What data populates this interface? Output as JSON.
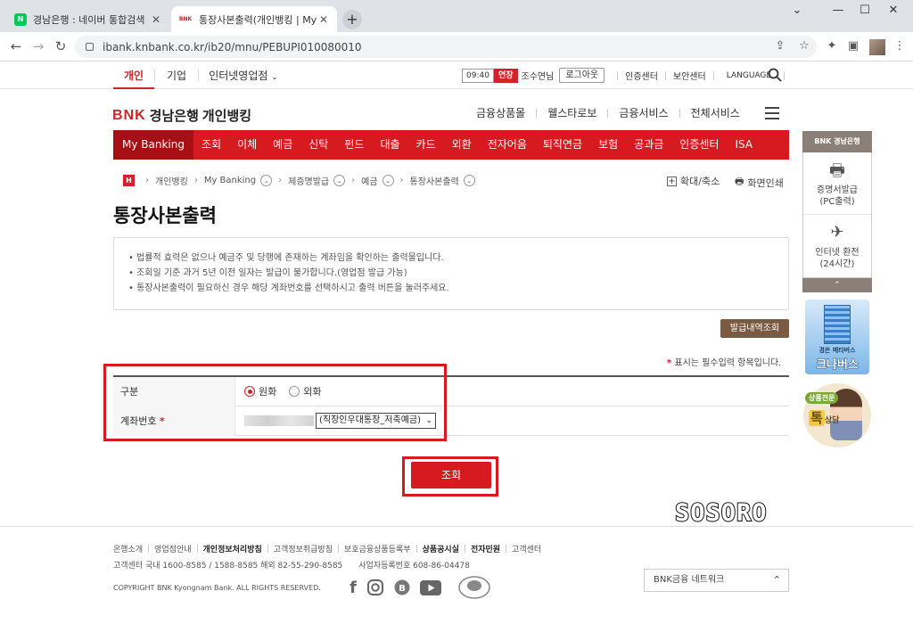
{
  "browser": {
    "tabs": [
      {
        "title": "경남은행 : 네이버 통합검색",
        "favicon": "N"
      },
      {
        "title": "통장사본출력(개인뱅킹 | My Ba",
        "favicon": "BNK"
      }
    ],
    "url": "ibank.knbank.co.kr/ib20/mnu/PEBUPI010080010"
  },
  "util": {
    "tabs": [
      "개인",
      "기업",
      "인터넷영업점"
    ],
    "timer": "09:40",
    "extend": "연장",
    "user": "조수연님",
    "logout": "로그아웃",
    "links": [
      "인증센터",
      "보안센터",
      "LANGUAGE"
    ]
  },
  "header": {
    "logo_mark": "BNK",
    "logo_text": "경남은행",
    "service": "개인뱅킹",
    "menu": [
      "금융상품몰",
      "웰스타로보",
      "금융서비스",
      "전체서비스"
    ]
  },
  "gnb": [
    "My Banking",
    "조회",
    "이체",
    "예금",
    "신탁",
    "펀드",
    "대출",
    "카드",
    "외환",
    "전자어음",
    "퇴직연금",
    "보험",
    "공과금",
    "인증센터",
    "ISA"
  ],
  "breadcrumb": [
    "개인뱅킹",
    "My Banking",
    "제증명발급",
    "예금",
    "통장사본출력"
  ],
  "tools": {
    "zoom": "확대/축소",
    "print": "화면인쇄"
  },
  "page_title": "통장사본출력",
  "notice": [
    "• 법률적 효력은 없으나 예금주 및 당행에 존재하는 계좌임을 확인하는 출력물입니다.",
    "• 조회일 기준 과거 5년 이전 일자는 발급이 불가합니다.(영업점 발급 가능)",
    "• 통장사본출력이 필요하신 경우 해당 계좌번호를 선택하시고 출력 버튼을 눌러주세요."
  ],
  "history_button": "발급내역조회",
  "required_note": {
    "mark": "*",
    "text": " 표시는 필수입력 항목입니다."
  },
  "form": {
    "type_label": "구분",
    "type_options": [
      "원화",
      "외화"
    ],
    "account_label": "계좌번호",
    "account_required": "*",
    "account_select": "(직장인우대통장_저축예금)"
  },
  "search_button": "조회",
  "watermark": "SOSORO",
  "footer": {
    "links": [
      "온행소개",
      "영업점안내",
      "개인정보처리방침",
      "고객정보취급방침",
      "보호금융상품등록부",
      "상품공시실",
      "전자민원",
      "고객센터"
    ],
    "bold_links": [
      "개인정보처리방침",
      "상품공시실",
      "전자민원"
    ],
    "contact": "고객센터 국내 1600-8585 / 1588-8585 해외 82-55-290-8585",
    "biz_no": "사업자등록번호 608-86-04478",
    "copyright": "COPYRIGHT BNK Kyongnam Bank. ALL RIGHTS RESERVED.",
    "network": "BNK금융 네트워크"
  },
  "quick": {
    "head": "BNK 경남은행",
    "items": [
      "증명서발급 (PC출력)",
      "인터넷 환전 (24시간)"
    ],
    "banner1": "경은 메타버스",
    "banner1_big": "크나버스",
    "banner2_tag": "상품전문",
    "banner2_big": "톡",
    "banner2_sub": "상담"
  },
  "colors": {
    "brand_red": "#d71920",
    "brown": "#7b5a42"
  }
}
